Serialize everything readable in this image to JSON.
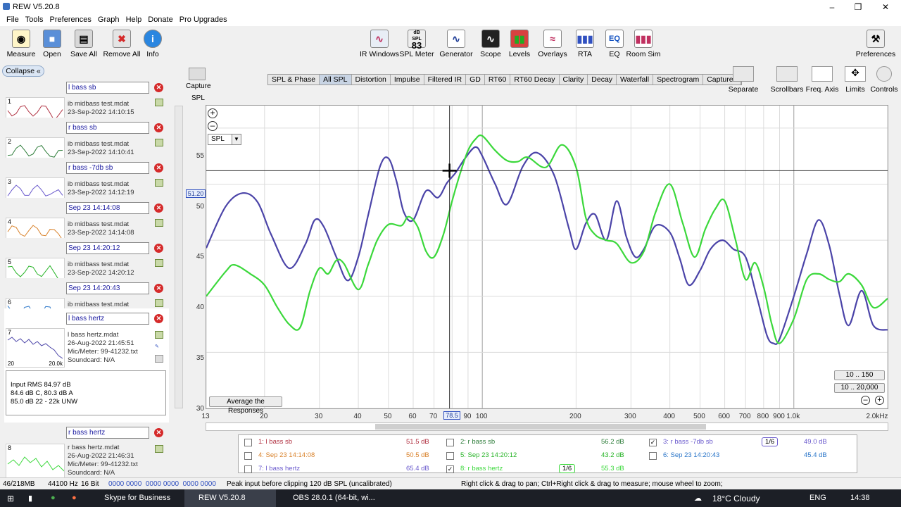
{
  "title": "REW V5.20.8",
  "menu": [
    "File",
    "Tools",
    "Preferences",
    "Graph",
    "Help",
    "Donate",
    "Pro Upgrades"
  ],
  "toolbar_left": [
    {
      "label": "Measure",
      "icon": "microphone-icon"
    },
    {
      "label": "Open",
      "icon": "folder-icon"
    },
    {
      "label": "Save All",
      "icon": "save-icon"
    },
    {
      "label": "Remove All",
      "icon": "remove-icon"
    },
    {
      "label": "Info",
      "icon": "info-icon"
    }
  ],
  "toolbar_center": [
    {
      "label": "IR Windows",
      "icon": "ir-windows-icon"
    },
    {
      "label": "SPL Meter",
      "icon": "spl-meter-icon",
      "badge_top": "dB SPL",
      "badge": "83"
    },
    {
      "label": "Generator",
      "icon": "generator-icon"
    },
    {
      "label": "Scope",
      "icon": "scope-icon"
    },
    {
      "label": "Levels",
      "icon": "levels-icon"
    },
    {
      "label": "Overlays",
      "icon": "overlays-icon"
    },
    {
      "label": "RTA",
      "icon": "rta-icon"
    },
    {
      "label": "EQ",
      "icon": "eq-icon"
    },
    {
      "label": "Room Sim",
      "icon": "room-sim-icon"
    }
  ],
  "preferences_label": "Preferences",
  "collapse_label": "Collapse",
  "measurements": [
    {
      "num": "1",
      "name": "l bass sb",
      "file": "ib midbass test.mdat",
      "date": "23-Sep-2022 14:10:15",
      "color": "#b03040"
    },
    {
      "num": "2",
      "name": "r bass sb",
      "file": "ib midbass test.mdat",
      "date": "23-Sep-2022 14:10:41",
      "color": "#2e7d3a"
    },
    {
      "num": "3",
      "name": "r bass -7db sb",
      "file": "ib midbass test.mdat",
      "date": "23-Sep-2022 14:12:19",
      "color": "#6a5acd"
    },
    {
      "num": "4",
      "name": "Sep 23 14:14:08",
      "file": "ib midbass test.mdat",
      "date": "23-Sep-2022 14:14:08",
      "color": "#d9822b"
    },
    {
      "num": "5",
      "name": "Sep 23 14:20:12",
      "file": "ib midbass test.mdat",
      "date": "23-Sep-2022 14:20:12",
      "color": "#28b428"
    },
    {
      "num": "6",
      "name": "Sep 23 14:20:43",
      "file": "ib midbass test.mdat",
      "date": "23-Sep-2022 14:20:43",
      "color": "#2874c8"
    }
  ],
  "selected": {
    "num": "7",
    "name": "l bass hertz",
    "file": "l bass hertz.mdat",
    "date": "26-Aug-2022 21:45:51",
    "mic": "Mic/Meter: 99-41232.txt",
    "soundcard": "Soundcard: N/A",
    "ax_left": "20",
    "ax_right": "20.0k"
  },
  "info_lines": [
    "Input RMS 84.97 dB",
    "84.6 dB C, 80.3 dB A",
    "85.0 dB 22 - 22k UNW"
  ],
  "meas8": {
    "num": "8",
    "name": "r bass hertz",
    "file": "r bass hertz.mdat",
    "date": "26-Aug-2022 21:46:31",
    "mic": "Mic/Meter: 99-41232.txt",
    "soundcard": "Soundcard: N/A"
  },
  "capture_label": "Capture",
  "spl_axis_label": "SPL",
  "tabs": [
    "SPL & Phase",
    "All SPL",
    "Distortion",
    "Impulse",
    "Filtered IR",
    "GD",
    "RT60",
    "RT60 Decay",
    "Clarity",
    "Decay",
    "Waterfall",
    "Spectrogram",
    "Captured"
  ],
  "active_tab": "All SPL",
  "right_toolbar": [
    {
      "label": "Separate",
      "icon": "separate-icon"
    },
    {
      "label": "Scrollbars",
      "icon": "scrollbars-icon"
    },
    {
      "label": "Freq. Axis",
      "icon": "freq-axis-icon"
    },
    {
      "label": "Limits",
      "icon": "limits-icon"
    },
    {
      "label": "Controls",
      "icon": "controls-icon"
    }
  ],
  "spl_select": "SPL",
  "cursor_value": "51.20",
  "cursor_freq": "78.5",
  "avg_button": "Average the Responses",
  "range_buttons": [
    "10 .. 150",
    "10 .. 20,000"
  ],
  "y_ticks": [
    "55",
    "50",
    "45",
    "40",
    "35",
    "30"
  ],
  "x_ticks": [
    "13",
    "20",
    "30",
    "40",
    "50",
    "60",
    "70",
    "90",
    "100",
    "200",
    "300",
    "400",
    "500",
    "600",
    "700",
    "800",
    "900",
    "1.0k",
    "2.0kHz"
  ],
  "chart_data": {
    "type": "line",
    "xlabel": "",
    "ylabel": "SPL",
    "x_scale": "log",
    "xlim": [
      13,
      2000
    ],
    "ylim": [
      30,
      57
    ],
    "series": [
      {
        "name": "3: r bass -7db sb",
        "color": "#4b44a8",
        "x": [
          13,
          15,
          17,
          19,
          21,
          24,
          27,
          29,
          31,
          34,
          37,
          40,
          43,
          47,
          50,
          53,
          56,
          60,
          66,
          72,
          77,
          82,
          88,
          95,
          100,
          110,
          120,
          135,
          150,
          170,
          190,
          200,
          215,
          230,
          250,
          270,
          290,
          310,
          330,
          360,
          400,
          430,
          460,
          500,
          540,
          590,
          640,
          700,
          760,
          820,
          860,
          900,
          1000,
          1100,
          1200,
          1300,
          1400,
          1500,
          1650,
          1800,
          2000
        ],
        "y": [
          44.3,
          48.0,
          49.2,
          48.4,
          45.5,
          42.5,
          44.6,
          46.8,
          46.2,
          43.5,
          41.4,
          43.5,
          47.2,
          51.6,
          52.3,
          50.3,
          47.5,
          46.8,
          49.4,
          48.8,
          50.1,
          51.0,
          52.3,
          53.3,
          52.5,
          50.0,
          48.2,
          51.6,
          52.8,
          50.8,
          46.0,
          44.2,
          46.5,
          47.3,
          45.0,
          48.5,
          45.3,
          43.5,
          44.2,
          46.3,
          45.7,
          43.4,
          41.0,
          42.3,
          44.2,
          45.0,
          44.2,
          43.5,
          40.0,
          36.5,
          35.8,
          36.2,
          40.0,
          43.8,
          46.8,
          44.5,
          40.2,
          37.4,
          40.5,
          37.4,
          37.0
        ]
      },
      {
        "name": "8: r bass hertz",
        "color": "#3bd83b",
        "x": [
          13,
          15,
          16,
          18,
          20,
          22,
          24,
          26,
          28,
          30,
          32,
          34,
          36,
          40,
          43,
          46,
          50,
          55,
          58,
          62,
          66,
          70,
          75,
          80,
          85,
          90,
          95,
          100,
          110,
          120,
          130,
          140,
          160,
          180,
          200,
          215,
          230,
          250,
          270,
          300,
          330,
          360,
          400,
          440,
          480,
          520,
          560,
          600,
          650,
          700,
          750,
          800,
          850,
          900,
          1000,
          1100,
          1200,
          1300,
          1400,
          1500,
          1650,
          1800,
          2000
        ],
        "y": [
          40.0,
          42.2,
          42.8,
          42.0,
          41.0,
          39.0,
          37.5,
          37.2,
          40.5,
          42.5,
          42.0,
          43.2,
          42.9,
          40.6,
          42.8,
          45.0,
          46.4,
          46.3,
          47.1,
          46.2,
          44.0,
          43.5,
          45.5,
          48.5,
          51.0,
          53.0,
          54.0,
          54.3,
          53.0,
          52.1,
          52.0,
          52.4,
          51.5,
          53.5,
          51.5,
          47.0,
          45.5,
          45.0,
          44.7,
          43.0,
          44.0,
          47.5,
          50.0,
          46.5,
          43.5,
          46.0,
          47.8,
          48.5,
          45.0,
          41.5,
          43.0,
          40.8,
          37.5,
          35.8,
          38.0,
          41.5,
          42.0,
          41.5,
          41.3,
          42.0,
          41.0,
          39.0,
          39.8
        ]
      }
    ]
  },
  "legend": [
    {
      "id": "1: l bass sb",
      "val": "51.5 dB",
      "color": "#b03040",
      "checked": false,
      "smooth": ""
    },
    {
      "id": "2: r bass sb",
      "val": "56.2 dB",
      "color": "#2e7d3a",
      "checked": false,
      "smooth": ""
    },
    {
      "id": "3: r bass -7db sb",
      "val": "49.0 dB",
      "color": "#6a5acd",
      "checked": true,
      "smooth": "1/6"
    },
    {
      "id": "4: Sep 23 14:14:08",
      "val": "50.5 dB",
      "color": "#d9822b",
      "checked": false,
      "smooth": ""
    },
    {
      "id": "5: Sep 23 14:20:12",
      "val": "43.2 dB",
      "color": "#28b428",
      "checked": false,
      "smooth": ""
    },
    {
      "id": "6: Sep 23 14:20:43",
      "val": "45.4 dB",
      "color": "#2874c8",
      "checked": false,
      "smooth": ""
    },
    {
      "id": "7: l bass hertz",
      "val": "65.4 dB",
      "color": "#6a5acd",
      "checked": false,
      "smooth": ""
    },
    {
      "id": "8: r bass hertz",
      "val": "55.3 dB",
      "color": "#3bd83b",
      "checked": true,
      "smooth": "1/6"
    }
  ],
  "status": {
    "memory": "46/218MB",
    "rate": "44100 Hz",
    "bits": "16 Bit",
    "levels": "0000 0000  0000 0000  0000 0000",
    "peak": "Peak input before clipping 120 dB SPL (uncalibrated)",
    "hint": "Right click & drag to pan; Ctrl+Right click & drag to measure; mouse wheel to zoom;"
  },
  "taskbar": {
    "items": [
      "Skype for Business",
      "REW V5.20.8",
      "OBS 28.0.1 (64-bit, wi..."
    ],
    "weather": "18°C  Cloudy",
    "lang": "ENG",
    "time": "14:38"
  }
}
